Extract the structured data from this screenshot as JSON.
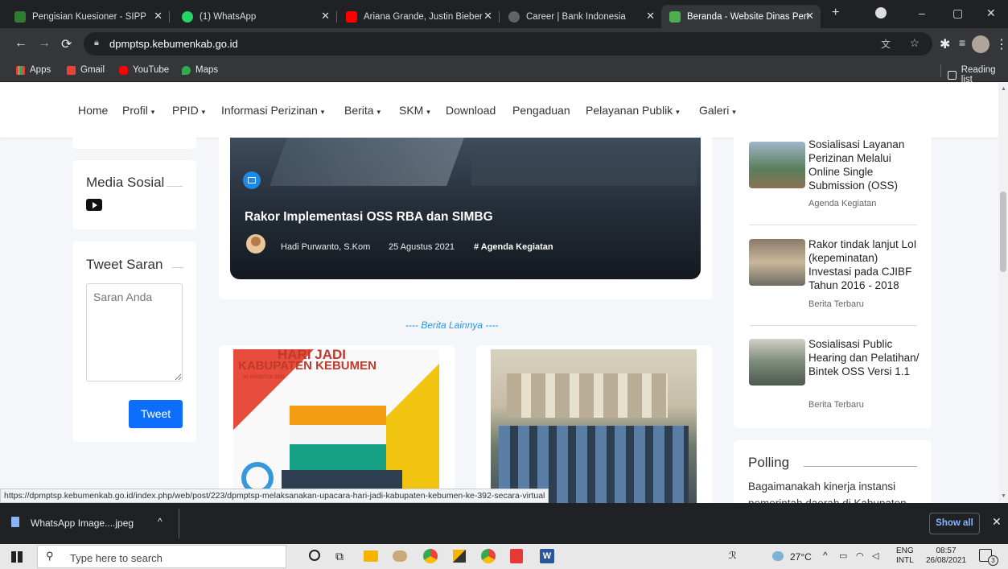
{
  "tabs": [
    {
      "title": "Pengisian Kuesioner - SIPP"
    },
    {
      "title": "(1) WhatsApp"
    },
    {
      "title": "Ariana Grande, Justin Bieber"
    },
    {
      "title": "Career | Bank Indonesia"
    },
    {
      "title": "Beranda - Website Dinas Pen"
    }
  ],
  "address": {
    "url": "dpmptsp.kebumenkab.go.id"
  },
  "bookmarks": {
    "apps": "Apps",
    "gmail": "Gmail",
    "youtube": "YouTube",
    "maps": "Maps",
    "reading_list": "Reading list"
  },
  "menu": [
    "Home",
    "Profil",
    "PPID",
    "Informasi Perizinan",
    "Berita",
    "SKM",
    "Download",
    "Pengaduan",
    "Pelayanan Publik",
    "Galeri"
  ],
  "left": {
    "media_title": "Media Sosial",
    "tweet_title": "Tweet Saran",
    "tweet_placeholder": "Saran Anda",
    "tweet_button": "Tweet"
  },
  "featured": {
    "title": "Rakor Implementasi OSS RBA dan SIMBG",
    "author": "Hadi Purwanto, S.Kom",
    "date": "25 Agustus 2021",
    "tag": "# Agenda Kegiatan"
  },
  "more_label": "---- Berita Lainnya ----",
  "thumb1": {
    "line1": "HARI JADI",
    "line2": "KABUPATEN KEBUMEN",
    "line3": "31 AGUSTUS 2021"
  },
  "sidebar_news": [
    {
      "title": "Sosialisasi Layanan Perizinan Melalui Online Single Submission (OSS)",
      "category": "Agenda Kegiatan"
    },
    {
      "title": "Rakor tindak lanjut LoI (kepeminatan) Investasi pada CJIBF Tahun 2016 - 2018",
      "category": "Berita Terbaru"
    },
    {
      "title": "Sosialisasi Public Hearing dan Pelatihan/ Bintek OSS Versi 1.1",
      "category": "Berita Terbaru"
    }
  ],
  "polling": {
    "title": "Polling",
    "question": "Bagaimanakah kinerja instansi pemerintah daerah di Kabupaten"
  },
  "status_url": "https://dpmptsp.kebumenkab.go.id/index.php/web/post/223/dpmptsp-melaksanakan-upacara-hari-jadi-kabupaten-kebumen-ke-392-secara-virtual",
  "download": {
    "file": "WhatsApp Image....jpeg",
    "show_all": "Show all"
  },
  "taskbar": {
    "search": "Type here to search",
    "temp": "27°C",
    "lang1": "ENG",
    "lang2": "INTL",
    "time": "08:57",
    "date": "26/08/2021",
    "notif": "3"
  },
  "colors": {
    "accent": "#1a73e8",
    "tweet_button": "#0d6efd",
    "more_label": "#2196f3"
  }
}
